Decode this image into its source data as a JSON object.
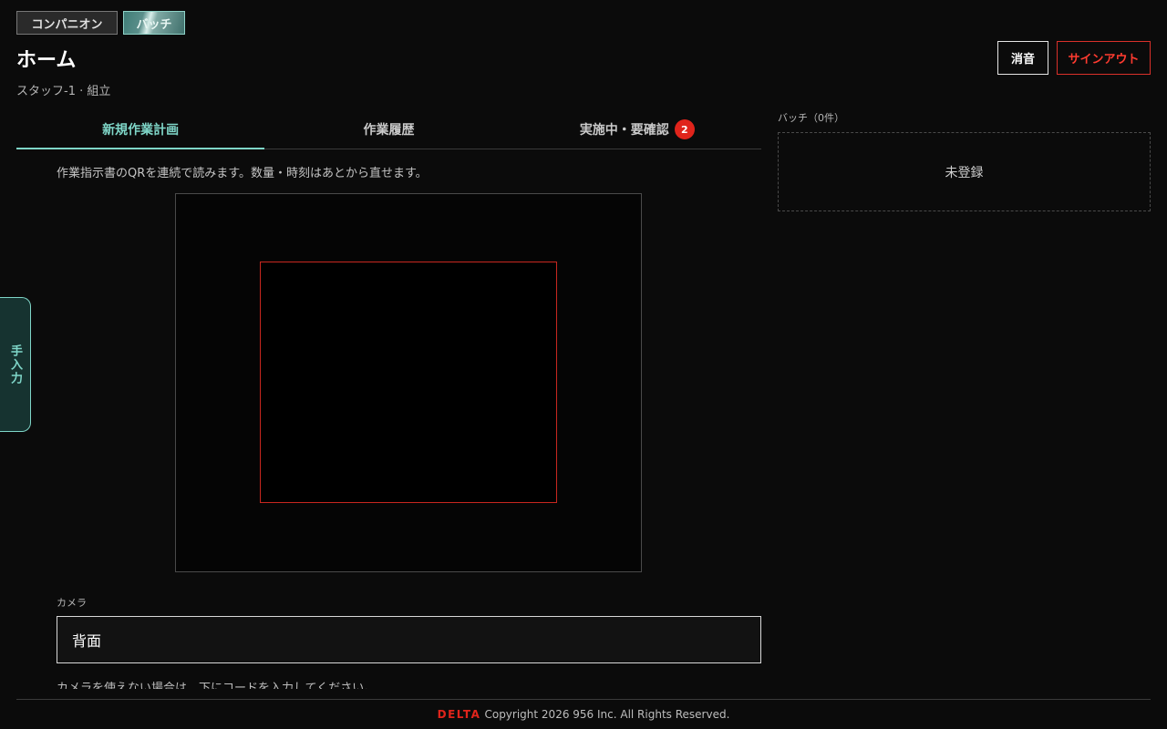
{
  "mode_switch": {
    "companion": "コンパニオン",
    "batch": "バッチ"
  },
  "header": {
    "title": "ホーム",
    "user": "スタッフ-1 · 組立",
    "mute": "消音",
    "signout": "サインアウト"
  },
  "tabs": [
    {
      "label": "新規作業計画",
      "active": true
    },
    {
      "label": "作業履歴",
      "active": false
    },
    {
      "label": "実施中・要確認",
      "active": false,
      "badge": "2"
    }
  ],
  "main": {
    "instruction": "作業指示書のQRを連続で読みます。数量・時刻はあとから直せます。",
    "camera_label": "カメラ",
    "camera_value": "背面",
    "cut_text": "カメラを使えない場合は、下にコードを入力してください。"
  },
  "side_tab": {
    "label": "手入力"
  },
  "batch": {
    "label": "バッチ（0件）",
    "empty": "未登録"
  },
  "footer": {
    "brand": "DELTA",
    "copyright": "Copyright 2026 956 Inc. All Rights Reserved."
  },
  "colors": {
    "accent": "#7fd6c8",
    "danger": "#e0241b",
    "background": "#0b0b0b"
  }
}
